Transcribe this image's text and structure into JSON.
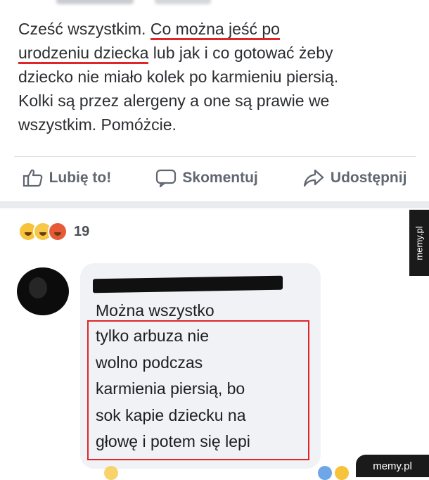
{
  "post": {
    "text_line1_pre": "Cześć wszystkim. ",
    "text_line1_hl": "Co można jeść po",
    "text_line2_hl": "urodzeniu dziecka",
    "text_line2_post": " lub jak i co gotować żeby",
    "text_line3": "dziecko nie miało kolek po karmieniu piersią.",
    "text_line4": "Kolki są przez alergeny a one są prawie we",
    "text_line5": "wszystkim. Pomóżcie."
  },
  "actions": {
    "like": "Lubię to!",
    "comment": "Skomentuj",
    "share": "Udostępnij"
  },
  "reactions": {
    "icons": [
      "haha-emoji-icon",
      "sad-emoji-icon",
      "angry-emoji-icon"
    ],
    "count": "19"
  },
  "comment": {
    "first_line": "Można wszystko",
    "lines": [
      "tylko arbuza nie",
      "wolno podczas",
      "karmienia piersią, bo",
      "sok kapie dziecku na",
      "głowę i potem się lepi"
    ]
  },
  "watermark": {
    "side": "memy.pl",
    "bottom": "memy.pl"
  },
  "colors": {
    "highlight_red": "#e0262b",
    "action_gray": "#606770",
    "bubble_bg": "#f0f2f5"
  }
}
